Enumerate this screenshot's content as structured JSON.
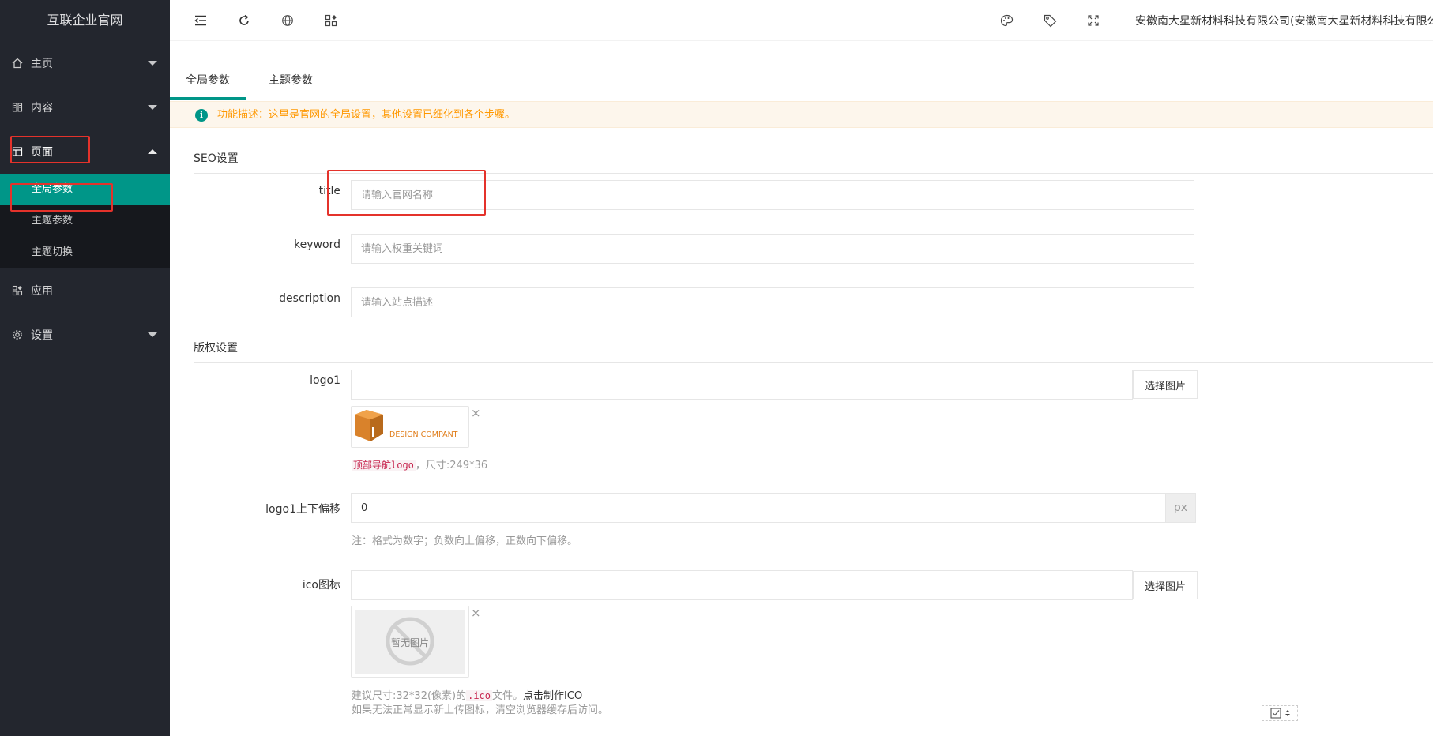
{
  "app": {
    "title": "互联企业官网"
  },
  "sidebar": {
    "items": [
      {
        "label": "主页",
        "icon": "home-icon"
      },
      {
        "label": "内容",
        "icon": "content-icon"
      },
      {
        "label": "页面",
        "icon": "page-icon"
      },
      {
        "label": "应用",
        "icon": "apps-icon"
      },
      {
        "label": "设置",
        "icon": "gear-icon"
      }
    ],
    "subitems": [
      {
        "label": "全局参数"
      },
      {
        "label": "主题参数"
      },
      {
        "label": "主题切换"
      }
    ]
  },
  "header": {
    "company": "安徽南大星新材料科技有限公司(安徽南大星新材料科技有限公司"
  },
  "tabs": [
    {
      "label": "全局参数"
    },
    {
      "label": "主题参数"
    }
  ],
  "notice": {
    "text": "功能描述：这里是官网的全局设置，其他设置已细化到各个步骤。"
  },
  "seo": {
    "section_title": "SEO设置",
    "title_label": "title",
    "title_placeholder": "请输入官网名称",
    "keyword_label": "keyword",
    "keyword_placeholder": "请输入权重关键词",
    "description_label": "description",
    "description_placeholder": "请输入站点描述"
  },
  "copyright": {
    "section_title": "版权设置",
    "logo1_label": "logo1",
    "pick_image": "选择图片",
    "logo_brand_text": "DESIGN COMPANT",
    "logo1_hint_code": "顶部导航logo",
    "logo1_hint_rest": "，尺寸:249*36",
    "offset_label": "logo1上下偏移",
    "offset_value": "0",
    "offset_unit": "px",
    "offset_hint": "注：格式为数字；负数向上偏移，正数向下偏移。",
    "ico_label": "ico图标",
    "no_image_text": "暂无图片",
    "ico_hint_prefix": "建议尺寸:32*32(像素)的",
    "ico_hint_code": ".ico",
    "ico_hint_mid": "文件。",
    "ico_hint_link": "点击制作ICO",
    "ico_hint_line2": "如果无法正常显示新上传图标，清空浏览器缓存后访问。"
  },
  "colors": {
    "accent": "#009688",
    "sidebar_bg": "#23262e",
    "warning": "#ff9800",
    "highlight": "#e4322b"
  }
}
